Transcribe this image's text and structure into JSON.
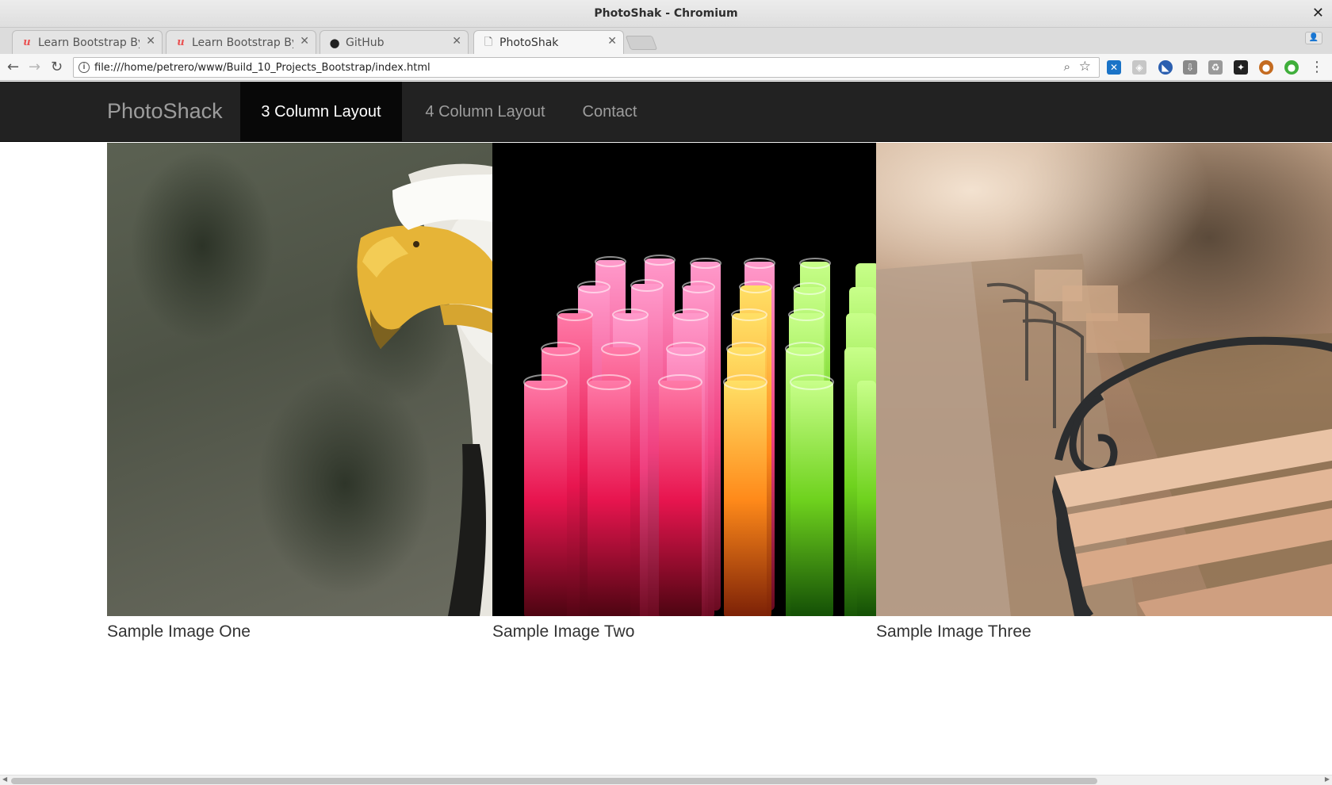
{
  "window": {
    "title": "PhotoShak - Chromium"
  },
  "tabs": [
    {
      "label": "Learn Bootstrap By",
      "icon": "udemy-icon",
      "active": false
    },
    {
      "label": "Learn Bootstrap By",
      "icon": "udemy-icon",
      "active": false
    },
    {
      "label": "GitHub",
      "icon": "github-icon",
      "active": false
    },
    {
      "label": "PhotoShak",
      "icon": "page-icon",
      "active": true
    }
  ],
  "toolbar": {
    "url": "file:///home/petrero/www/Build_10_Projects_Bootstrap/index.html"
  },
  "navbar": {
    "brand": "PhotoShack",
    "items": [
      {
        "label": "3 Column Layout",
        "active": true
      },
      {
        "label": "4 Column Layout",
        "active": false
      },
      {
        "label": "Contact",
        "active": false
      }
    ]
  },
  "gallery": [
    {
      "caption": "Sample Image One"
    },
    {
      "caption": "Sample Image Two"
    },
    {
      "caption": "Sample Image Three"
    }
  ],
  "colors": {
    "navbar_bg": "#222222",
    "navbar_active_bg": "#080808",
    "nav_text": "#9d9d9d"
  }
}
